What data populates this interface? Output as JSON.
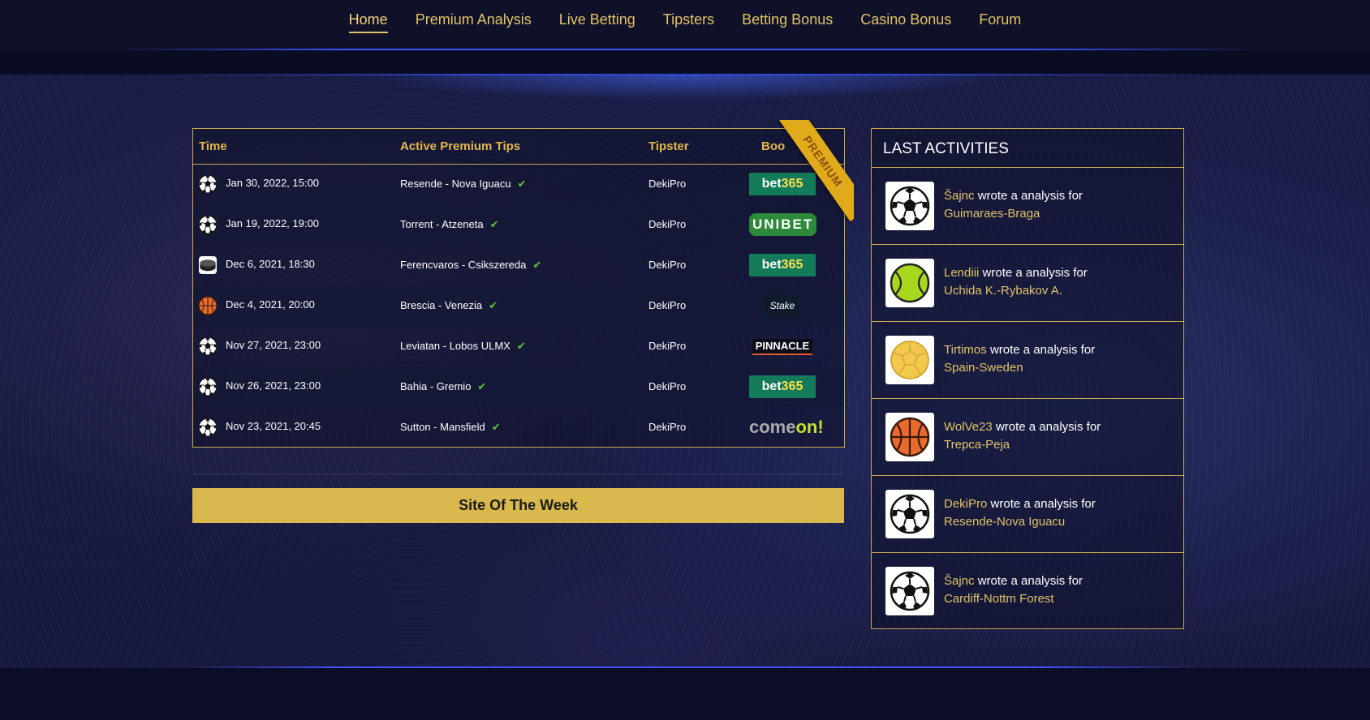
{
  "nav": {
    "items": [
      "Home",
      "Premium Analysis",
      "Live Betting",
      "Tipsters",
      "Betting Bonus",
      "Casino Bonus",
      "Forum"
    ],
    "active": "Home"
  },
  "tips": {
    "headers": {
      "time": "Time",
      "tips": "Active Premium Tips",
      "tipster": "Tipster",
      "book": "Boo"
    },
    "ribbon": "PREMIUM",
    "rows": [
      {
        "sport": "soccer-ball-icon",
        "time": "Jan 30, 2022, 15:00",
        "match": "Resende - Nova Iguacu",
        "tipster": "DekiPro",
        "bookmaker": "bet365"
      },
      {
        "sport": "soccer-ball-icon",
        "time": "Jan 19, 2022, 19:00",
        "match": "Torrent - Atzeneta",
        "tipster": "DekiPro",
        "bookmaker": "UNIBET"
      },
      {
        "sport": "hockey-puck-icon",
        "time": "Dec 6, 2021, 18:30",
        "match": "Ferencvaros - Csikszereda",
        "tipster": "DekiPro",
        "bookmaker": "bet365"
      },
      {
        "sport": "basketball-icon",
        "time": "Dec 4, 2021, 20:00",
        "match": "Brescia - Venezia",
        "tipster": "DekiPro",
        "bookmaker": "Stake"
      },
      {
        "sport": "soccer-ball-icon",
        "time": "Nov 27, 2021, 23:00",
        "match": "Leviatan - Lobos ULMX",
        "tipster": "DekiPro",
        "bookmaker": "PINNACLE"
      },
      {
        "sport": "soccer-ball-icon",
        "time": "Nov 26, 2021, 23:00",
        "match": "Bahia - Gremio",
        "tipster": "DekiPro",
        "bookmaker": "bet365"
      },
      {
        "sport": "soccer-ball-icon",
        "time": "Nov 23, 2021, 20:45",
        "match": "Sutton - Mansfield",
        "tipster": "DekiPro",
        "bookmaker": "comeon!"
      }
    ]
  },
  "site_of_week": {
    "label": "Site Of The Week"
  },
  "activities": {
    "title": "LAST ACTIVITIES",
    "items": [
      {
        "icon": "soccer-ball-icon",
        "user": "Šajnc",
        "action": "wrote a analysis for",
        "target": "Guimaraes-Braga"
      },
      {
        "icon": "tennis-ball-icon",
        "user": "Lendiii",
        "action": "wrote a analysis for",
        "target": "Uchida K.-Rybakov A."
      },
      {
        "icon": "handball-icon",
        "user": "Tirtimos",
        "action": "wrote a analysis for",
        "target": "Spain-Sweden"
      },
      {
        "icon": "basketball-icon",
        "user": "WolVe23",
        "action": "wrote a analysis for",
        "target": "Trepca-Peja"
      },
      {
        "icon": "soccer-ball-icon",
        "user": "DekiPro",
        "action": "wrote a analysis for",
        "target": "Resende-Nova Iguacu"
      },
      {
        "icon": "soccer-ball-icon",
        "user": "Šajnc",
        "action": "wrote a analysis for",
        "target": "Cardiff-Nottm Forest"
      }
    ]
  },
  "colors": {
    "gold": "#e2c36a",
    "bet365": "#137a5a",
    "unibet": "#2d8a3a",
    "check": "#5ec43a"
  }
}
